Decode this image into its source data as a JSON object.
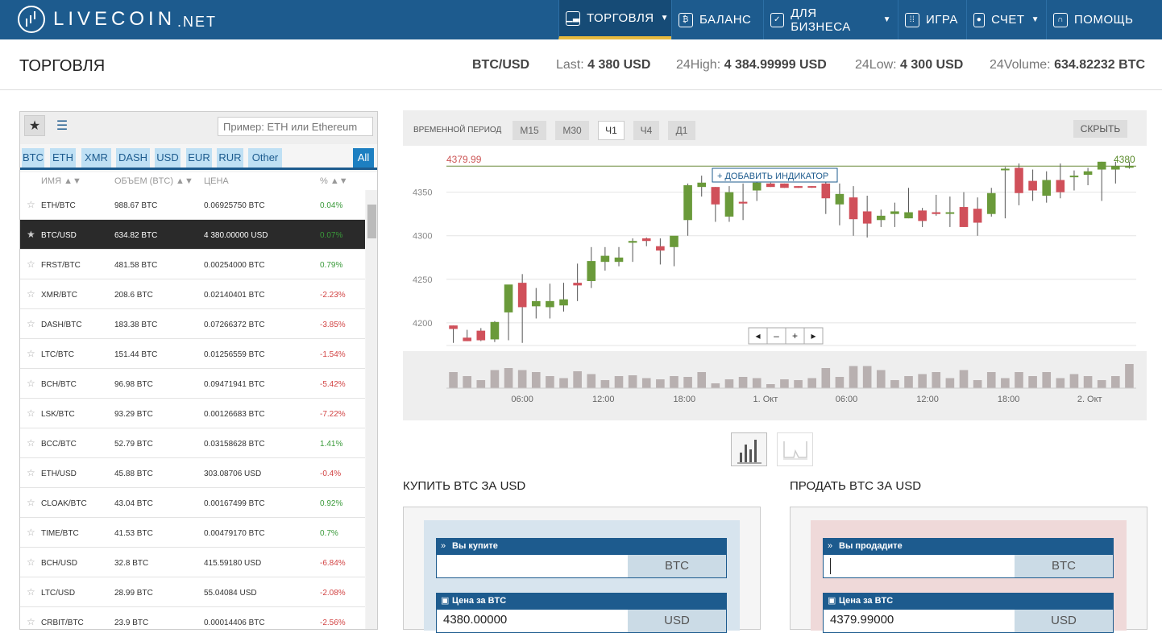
{
  "brand": {
    "name": "LIVECOIN",
    "tld": ".NET"
  },
  "nav": [
    {
      "label": "ТОРГОВЛЯ",
      "icon": "chart-icon",
      "dropdown": true,
      "active": true
    },
    {
      "label": "БАЛАНС",
      "icon": "wallet-icon",
      "dropdown": false
    },
    {
      "label": "ДЛЯ БИЗНЕСА",
      "icon": "briefcase-check-icon",
      "dropdown": true
    },
    {
      "label": "ИГРА",
      "icon": "grid-icon",
      "dropdown": false
    },
    {
      "label": "СЧЕТ",
      "icon": "account-icon",
      "dropdown": true
    },
    {
      "label": "ПОМОЩЬ",
      "icon": "headset-icon",
      "dropdown": false
    }
  ],
  "page": {
    "title": "ТОРГОВЛЯ"
  },
  "ticker": {
    "pair": "BTC/USD",
    "last_label": "Last:",
    "last": "4 380 USD",
    "high_label": "24High:",
    "high": "4 384.99999 USD",
    "low_label": "24Low:",
    "low": "4 300 USD",
    "volume_label": "24Volume:",
    "volume": "634.82232 BTC"
  },
  "markets": {
    "search_placeholder": "Пример: ETH или Ethereum",
    "filters": [
      "BTC",
      "ETH",
      "XMR",
      "DASH",
      "USD",
      "EUR",
      "RUR",
      "Other",
      "All"
    ],
    "columns": {
      "name": "ИМЯ ▲▼",
      "volume": "ОБЪЕМ (BTC) ▲▼",
      "price": "ЦЕНА",
      "change": "% ▲▼"
    },
    "rows": [
      {
        "pair": "ETH/BTC",
        "volume": "988.67 BTC",
        "price": "0.06925750 BTC",
        "change": "0.04%",
        "up": true
      },
      {
        "pair": "BTC/USD",
        "volume": "634.82 BTC",
        "price": "4 380.00000 USD",
        "change": "0.07%",
        "up": true,
        "selected": true
      },
      {
        "pair": "FRST/BTC",
        "volume": "481.58 BTC",
        "price": "0.00254000 BTC",
        "change": "0.79%",
        "up": true
      },
      {
        "pair": "XMR/BTC",
        "volume": "208.6 BTC",
        "price": "0.02140401 BTC",
        "change": "-2.23%",
        "up": false
      },
      {
        "pair": "DASH/BTC",
        "volume": "183.38 BTC",
        "price": "0.07266372 BTC",
        "change": "-3.85%",
        "up": false
      },
      {
        "pair": "LTC/BTC",
        "volume": "151.44 BTC",
        "price": "0.01256559 BTC",
        "change": "-1.54%",
        "up": false
      },
      {
        "pair": "BCH/BTC",
        "volume": "96.98 BTC",
        "price": "0.09471941 BTC",
        "change": "-5.42%",
        "up": false
      },
      {
        "pair": "LSK/BTC",
        "volume": "93.29 BTC",
        "price": "0.00126683 BTC",
        "change": "-7.22%",
        "up": false
      },
      {
        "pair": "BCC/BTC",
        "volume": "52.79 BTC",
        "price": "0.03158628 BTC",
        "change": "1.41%",
        "up": true
      },
      {
        "pair": "ETH/USD",
        "volume": "45.88 BTC",
        "price": "303.08706 USD",
        "change": "-0.4%",
        "up": false
      },
      {
        "pair": "CLOAK/BTC",
        "volume": "43.04 BTC",
        "price": "0.00167499 BTC",
        "change": "0.92%",
        "up": true
      },
      {
        "pair": "TIME/BTC",
        "volume": "41.53 BTC",
        "price": "0.00479170 BTC",
        "change": "0.7%",
        "up": true
      },
      {
        "pair": "BCH/USD",
        "volume": "32.8 BTC",
        "price": "415.59180 USD",
        "change": "-6.84%",
        "up": false
      },
      {
        "pair": "LTC/USD",
        "volume": "28.99 BTC",
        "price": "55.04084 USD",
        "change": "-2.08%",
        "up": false
      },
      {
        "pair": "CRBIT/BTC",
        "volume": "23.9 BTC",
        "price": "0.00014406 BTC",
        "change": "-2.56%",
        "up": false
      }
    ]
  },
  "chart": {
    "period_label": "ВРЕМЕННОЙ ПЕРИОД",
    "timeframes": [
      "M15",
      "M30",
      "Ч1",
      "Ч4",
      "Д1"
    ],
    "active_timeframe": "Ч1",
    "hide_label": "СКРЫТЬ",
    "add_indicator": "ДОБАВИТЬ ИНДИКАТОР",
    "zoom_controls": [
      "◂",
      "–",
      "+",
      "▸"
    ],
    "colors": {
      "up": "#6a9a3a",
      "down": "#d0505a",
      "volume": "#b8b0b0"
    }
  },
  "chart_data": {
    "type": "candlestick",
    "y_ticks": [
      4200,
      4250,
      4300,
      4350
    ],
    "ylim": [
      4174,
      4395
    ],
    "x_ticks": [
      "06:00",
      "12:00",
      "18:00",
      "1. Окт",
      "06:00",
      "12:00",
      "18:00",
      "2. Окт"
    ],
    "price_lines": [
      {
        "label": "4379.99",
        "value": 4379.99
      },
      {
        "label": "4380",
        "value": 4380
      }
    ],
    "candles": [
      {
        "o": 4197,
        "h": 4197,
        "l": 4177,
        "c": 4193
      },
      {
        "o": 4183,
        "h": 4192,
        "l": 4179,
        "c": 4179
      },
      {
        "o": 4191,
        "h": 4194,
        "l": 4179,
        "c": 4180
      },
      {
        "o": 4181,
        "h": 4202,
        "l": 4178,
        "c": 4201
      },
      {
        "o": 4212,
        "h": 4242,
        "l": 4180,
        "c": 4244
      },
      {
        "o": 4246,
        "h": 4256,
        "l": 4177,
        "c": 4218
      },
      {
        "o": 4219,
        "h": 4240,
        "l": 4205,
        "c": 4225
      },
      {
        "o": 4218,
        "h": 4245,
        "l": 4205,
        "c": 4225
      },
      {
        "o": 4220,
        "h": 4246,
        "l": 4213,
        "c": 4227
      },
      {
        "o": 4246,
        "h": 4268,
        "l": 4225,
        "c": 4243
      },
      {
        "o": 4248,
        "h": 4287,
        "l": 4240,
        "c": 4271
      },
      {
        "o": 4270,
        "h": 4287,
        "l": 4260,
        "c": 4277
      },
      {
        "o": 4270,
        "h": 4287,
        "l": 4265,
        "c": 4275
      },
      {
        "o": 4292,
        "h": 4297,
        "l": 4270,
        "c": 4294
      },
      {
        "o": 4297,
        "h": 4298,
        "l": 4288,
        "c": 4294
      },
      {
        "o": 4288,
        "h": 4297,
        "l": 4267,
        "c": 4283
      },
      {
        "o": 4287,
        "h": 4297,
        "l": 4265,
        "c": 4300
      },
      {
        "o": 4318,
        "h": 4360,
        "l": 4300,
        "c": 4358
      },
      {
        "o": 4356,
        "h": 4369,
        "l": 4345,
        "c": 4361
      },
      {
        "o": 4356,
        "h": 4356,
        "l": 4316,
        "c": 4336
      },
      {
        "o": 4322,
        "h": 4357,
        "l": 4316,
        "c": 4350
      },
      {
        "o": 4339,
        "h": 4360,
        "l": 4318,
        "c": 4337
      },
      {
        "o": 4352,
        "h": 4367,
        "l": 4340,
        "c": 4361
      },
      {
        "o": 4360,
        "h": 4361,
        "l": 4356,
        "c": 4356
      },
      {
        "o": 4360,
        "h": 4360,
        "l": 4355,
        "c": 4355
      },
      {
        "o": 4357,
        "h": 4357,
        "l": 4355,
        "c": 4355
      },
      {
        "o": 4357,
        "h": 4357,
        "l": 4355,
        "c": 4356
      },
      {
        "o": 4360,
        "h": 4369,
        "l": 4325,
        "c": 4343
      },
      {
        "o": 4336,
        "h": 4360,
        "l": 4312,
        "c": 4348
      },
      {
        "o": 4344,
        "h": 4357,
        "l": 4300,
        "c": 4319
      },
      {
        "o": 4328,
        "h": 4346,
        "l": 4298,
        "c": 4314
      },
      {
        "o": 4318,
        "h": 4330,
        "l": 4310,
        "c": 4323
      },
      {
        "o": 4325,
        "h": 4338,
        "l": 4310,
        "c": 4328
      },
      {
        "o": 4320,
        "h": 4355,
        "l": 4320,
        "c": 4327
      },
      {
        "o": 4329,
        "h": 4332,
        "l": 4310,
        "c": 4317
      },
      {
        "o": 4327,
        "h": 4347,
        "l": 4323,
        "c": 4325
      },
      {
        "o": 4327,
        "h": 4345,
        "l": 4310,
        "c": 4327
      },
      {
        "o": 4333,
        "h": 4350,
        "l": 4310,
        "c": 4310
      },
      {
        "o": 4331,
        "h": 4344,
        "l": 4300,
        "c": 4315
      },
      {
        "o": 4325,
        "h": 4355,
        "l": 4322,
        "c": 4349
      },
      {
        "o": 4376,
        "h": 4379,
        "l": 4320,
        "c": 4377
      },
      {
        "o": 4378,
        "h": 4383,
        "l": 4335,
        "c": 4349
      },
      {
        "o": 4363,
        "h": 4376,
        "l": 4340,
        "c": 4352
      },
      {
        "o": 4346,
        "h": 4374,
        "l": 4338,
        "c": 4364
      },
      {
        "o": 4364,
        "h": 4383,
        "l": 4343,
        "c": 4350
      },
      {
        "o": 4368,
        "h": 4375,
        "l": 4352,
        "c": 4369
      },
      {
        "o": 4370,
        "h": 4378,
        "l": 4358,
        "c": 4374
      },
      {
        "o": 4376,
        "h": 4385,
        "l": 4340,
        "c": 4385
      },
      {
        "o": 4376,
        "h": 4385,
        "l": 4360,
        "c": 4380
      },
      {
        "o": 4380,
        "h": 4385,
        "l": 4377,
        "c": 4380
      }
    ],
    "volume": [
      40,
      30,
      20,
      45,
      50,
      45,
      40,
      30,
      25,
      42,
      35,
      20,
      30,
      32,
      25,
      22,
      30,
      28,
      40,
      12,
      22,
      28,
      25,
      10,
      22,
      20,
      25,
      50,
      28,
      55,
      55,
      45,
      20,
      30,
      35,
      40,
      25,
      45,
      20,
      40,
      25,
      40,
      30,
      40,
      25,
      35,
      30,
      20,
      30,
      60
    ]
  },
  "buy": {
    "title": "КУПИТЬ BTC ЗА USD",
    "amount_label": "Вы купите",
    "amount_value": "",
    "amount_currency": "BTC",
    "price_label": "Цена за BTC",
    "price_value": "4380.00000",
    "price_currency": "USD"
  },
  "sell": {
    "title": "ПРОДАТЬ BTC ЗА USD",
    "amount_label": "Вы продадите",
    "amount_value": "",
    "amount_currency": "BTC",
    "price_label": "Цена за BTC",
    "price_value": "4379.99000",
    "price_currency": "USD"
  }
}
